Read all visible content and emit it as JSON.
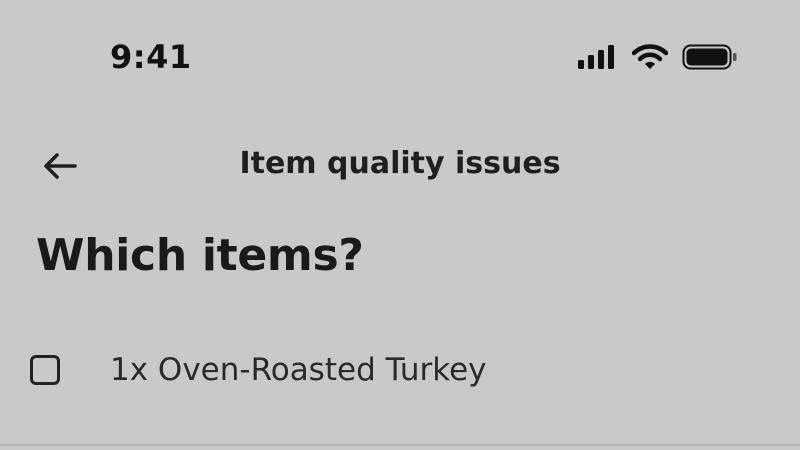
{
  "status_bar": {
    "time": "9:41",
    "icons": [
      "signal-icon",
      "wifi-icon",
      "battery-icon"
    ]
  },
  "header": {
    "back_icon": "arrow-left-icon",
    "title": "Item quality issues"
  },
  "main": {
    "heading": "Which items?",
    "items": [
      {
        "label": "1x Oven-Roasted Turkey",
        "checked": false
      }
    ]
  },
  "colors": {
    "background": "#c9c9c9",
    "text": "#1f1f1f"
  }
}
